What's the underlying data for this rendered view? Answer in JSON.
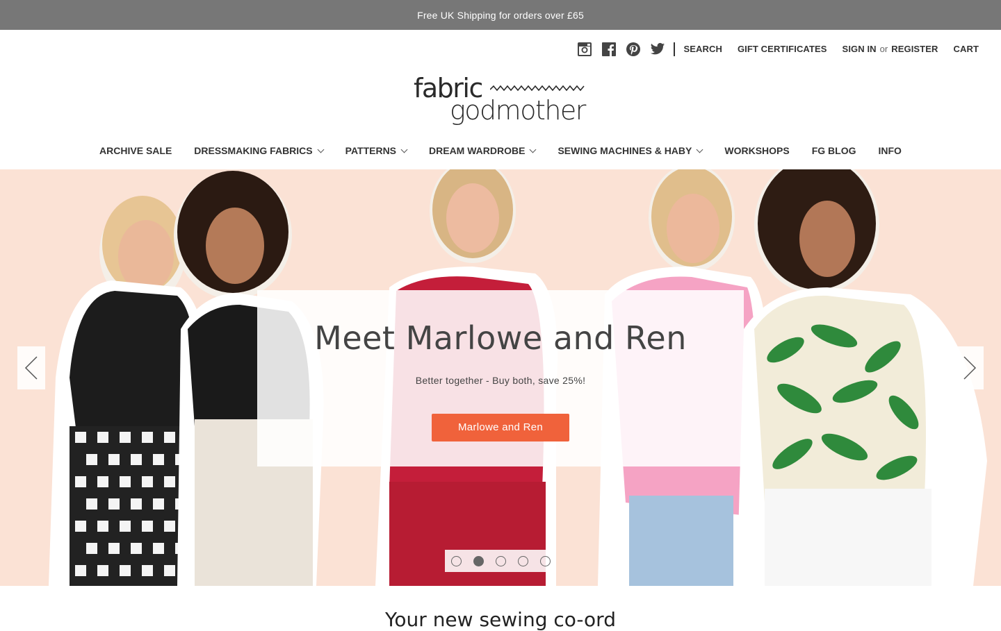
{
  "announcement": "Free UK Shipping for orders over £65",
  "topnav": {
    "social": [
      "instagram-icon",
      "facebook-icon",
      "pinterest-icon",
      "twitter-icon"
    ],
    "search": "SEARCH",
    "gift": "GIFT CERTIFICATES",
    "signin": "SIGN IN",
    "or": "or",
    "register": "REGISTER",
    "cart": "CART"
  },
  "logo": {
    "top": "fabric",
    "bottom": "godmother"
  },
  "nav": [
    {
      "label": "ARCHIVE SALE"
    },
    {
      "label": "DRESSMAKING FABRICS"
    },
    {
      "label": "PATTERNS"
    },
    {
      "label": "DREAM WARDROBE"
    },
    {
      "label": "SEWING MACHINES & HABY"
    },
    {
      "label": "WORKSHOPS"
    },
    {
      "label": "FG BLOG"
    },
    {
      "label": "INFO"
    }
  ],
  "hero": {
    "title": "Meet Marlowe and Ren",
    "subtitle": "Better together - Buy both, save 25%!",
    "button": "Marlowe and Ren",
    "slides": 5,
    "active_slide": 2
  },
  "section_heading": "Your new sewing co-ord",
  "colors": {
    "announce_bg": "#777777",
    "cta": "#f0623b",
    "hero_bg": "#fbe2d5"
  }
}
